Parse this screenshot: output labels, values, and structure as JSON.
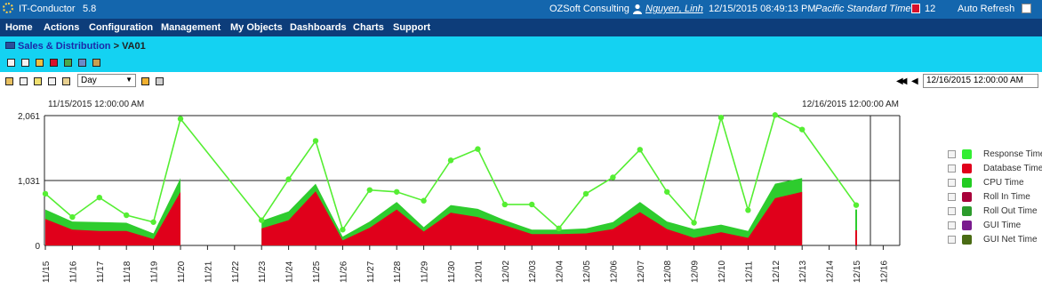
{
  "header": {
    "app_name": "IT-Conductor",
    "version": "5.8",
    "company": "OZSoft Consulting",
    "user": "Nguyen, Linh",
    "datetime": "12/15/2015 08:49:13 PM",
    "timezone": "Pacific Standard Time",
    "alert_count": "12",
    "auto_refresh": "Auto Refresh"
  },
  "menu": [
    "Home",
    "Actions",
    "Configuration",
    "Management",
    "My Objects",
    "Dashboards",
    "Charts",
    "Support"
  ],
  "breadcrumb": {
    "parent": "Sales & Distribution",
    "separator": ">",
    "current": "VA01"
  },
  "controls": {
    "period": "Day",
    "date_value": "12/16/2015 12:00:00 AM"
  },
  "colors": {
    "title_bar": "#1466ad",
    "menu_bar": "#0d3d7a",
    "crumb_bar": "#14d2f2",
    "response": "#55ee33",
    "database": "#e0001b",
    "cpu": "#2ecc2e",
    "roll_in": "#a8003a",
    "roll_out": "#2c9b2c",
    "gui": "#7a1b8e",
    "gui_net": "#4a6b14"
  },
  "legend": [
    {
      "name": "Response Time",
      "color": "#33ee33"
    },
    {
      "name": "Database Time",
      "color": "#e0001b"
    },
    {
      "name": "CPU Time",
      "color": "#22cc22"
    },
    {
      "name": "Roll In Time",
      "color": "#a8003a"
    },
    {
      "name": "Roll Out Time",
      "color": "#2c9b2c"
    },
    {
      "name": "GUI Time",
      "color": "#7a1b8e"
    },
    {
      "name": "GUI Net Time",
      "color": "#4a6b14"
    }
  ],
  "chart_data": {
    "type": "line",
    "range_start_label": "11/15/2015 12:00:00 AM",
    "range_end_label": "12/16/2015 12:00:00 AM",
    "categories": [
      "11/15",
      "11/16",
      "11/17",
      "11/18",
      "11/19",
      "11/20",
      "11/21",
      "11/22",
      "11/23",
      "11/24",
      "11/25",
      "11/26",
      "11/27",
      "11/28",
      "11/29",
      "11/30",
      "12/01",
      "12/02",
      "12/03",
      "12/04",
      "12/05",
      "12/06",
      "12/07",
      "12/08",
      "12/09",
      "12/10",
      "12/11",
      "12/12",
      "12/13",
      "12/14",
      "12/15",
      "12/16"
    ],
    "yticks": [
      "2,061",
      "1,031",
      "0"
    ],
    "ylim": [
      0,
      2061
    ],
    "series": [
      {
        "name": "Response Time",
        "values": [
          820,
          450,
          760,
          480,
          370,
          2010,
          null,
          null,
          400,
          1050,
          1660,
          250,
          880,
          850,
          710,
          1350,
          1530,
          650,
          650,
          270,
          820,
          1080,
          1520,
          850,
          360,
          2030,
          560,
          2070,
          1840,
          null,
          640
        ]
      },
      {
        "name": "Database Time",
        "values": [
          420,
          250,
          230,
          230,
          100,
          850,
          null,
          null,
          270,
          400,
          860,
          80,
          280,
          570,
          220,
          520,
          450,
          320,
          180,
          180,
          190,
          260,
          530,
          260,
          120,
          210,
          120,
          750,
          850,
          null,
          240
        ]
      },
      {
        "name": "CPU Time",
        "values": [
          150,
          130,
          140,
          130,
          90,
          220,
          null,
          null,
          120,
          140,
          120,
          60,
          100,
          120,
          70,
          120,
          130,
          80,
          70,
          70,
          80,
          110,
          160,
          120,
          140,
          120,
          110,
          230,
          220,
          null,
          330
        ]
      }
    ]
  }
}
